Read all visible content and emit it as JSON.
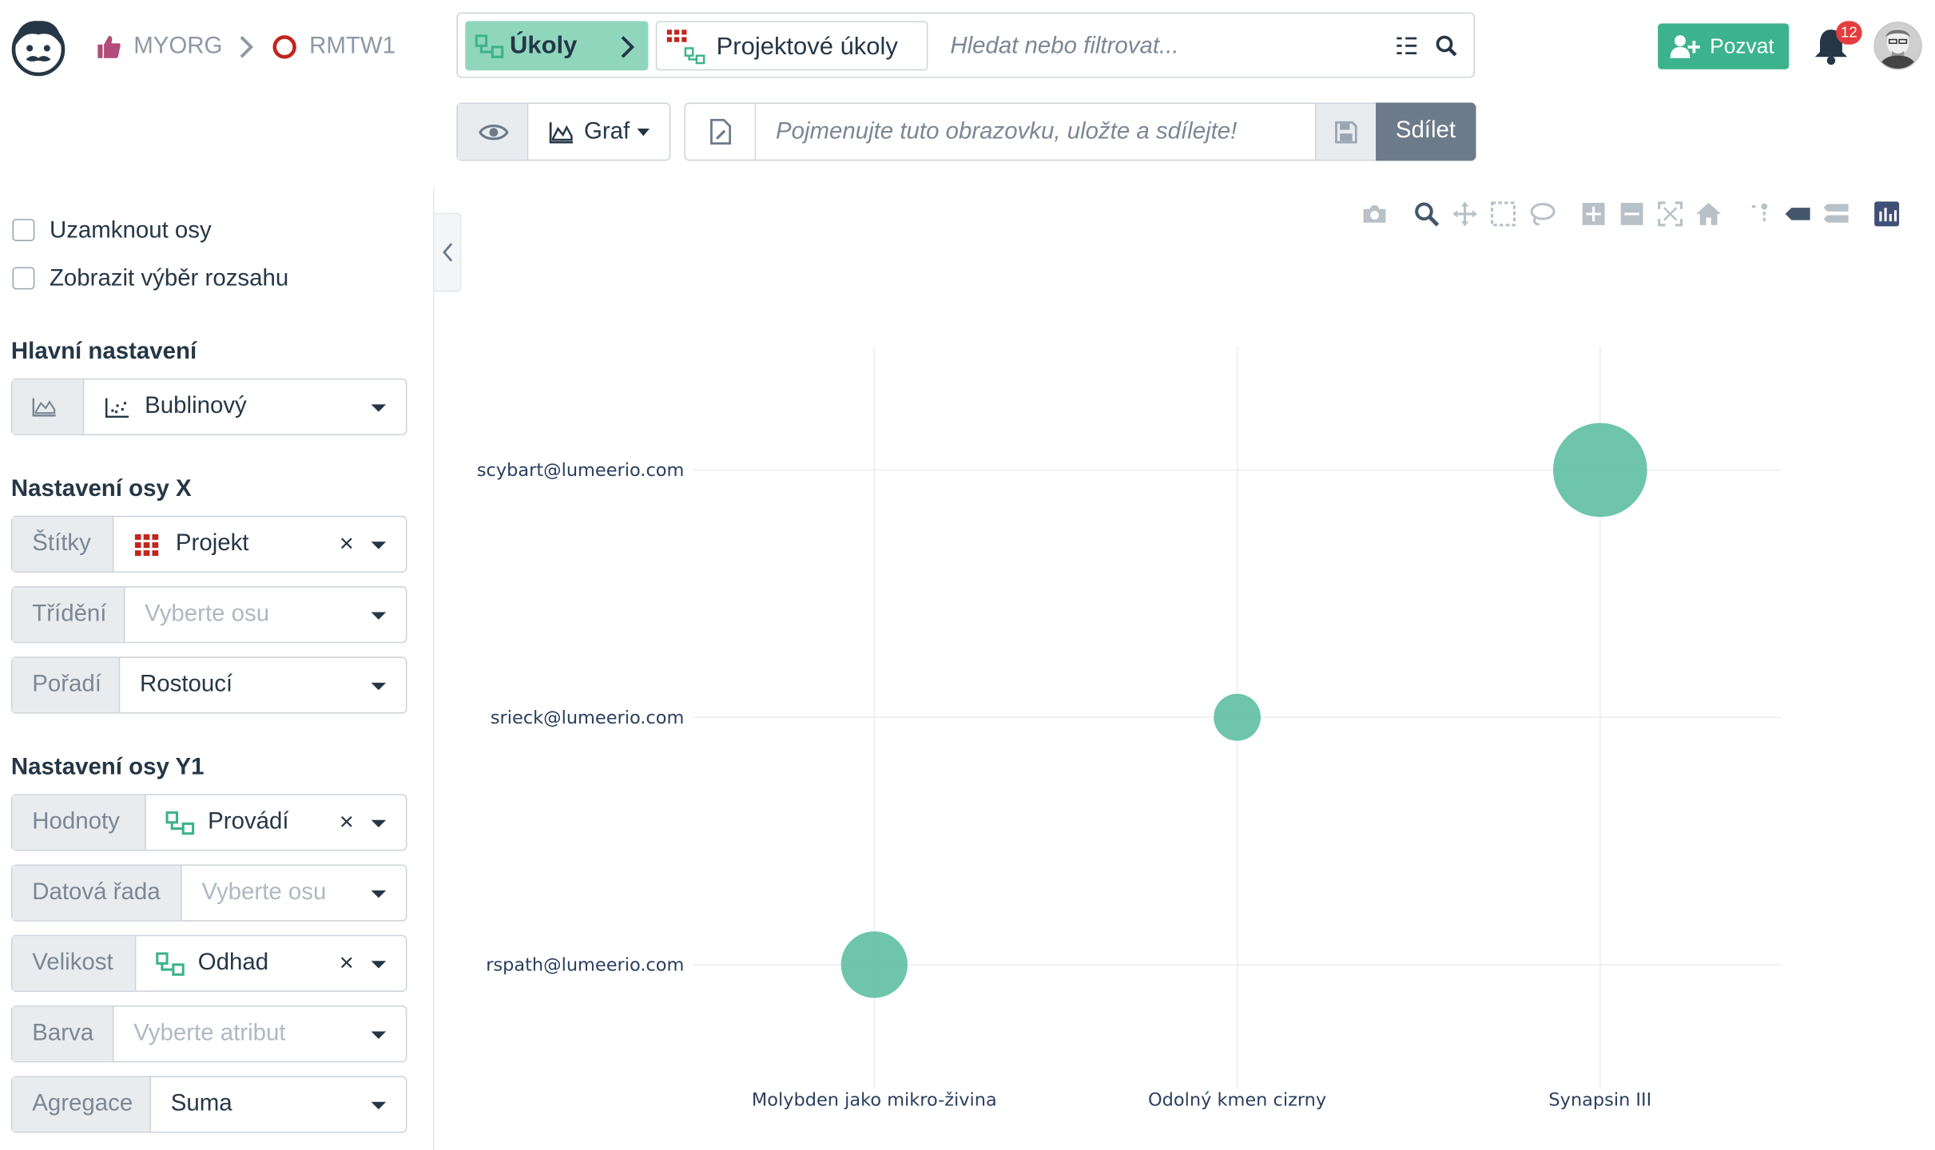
{
  "header": {
    "org": "MYORG",
    "project": "RMTW1",
    "collection_chip": "Úkoly",
    "view_chip": "Projektové úkoly",
    "search_placeholder": "Hledat nebo filtrovat...",
    "invite_label": "Pozvat",
    "notification_count": "12"
  },
  "toolbar": {
    "view_type": "Graf",
    "name_placeholder": "Pojmenujte tuto obrazovku, uložte a sdílejte!",
    "share_label": "Sdílet"
  },
  "sidebar": {
    "lock_axes": "Uzamknout osy",
    "show_range": "Zobrazit výběr rozsahu",
    "main_settings_title": "Hlavní nastavení",
    "chart_type": "Bublinový",
    "x_axis_title": "Nastavení osy X",
    "x_fields": [
      {
        "label": "Štítky",
        "value": "Projekt",
        "placeholder": false,
        "clearable": true
      },
      {
        "label": "Třídění",
        "value": "Vyberte osu",
        "placeholder": true,
        "clearable": false
      },
      {
        "label": "Pořadí",
        "value": "Rostoucí",
        "placeholder": false,
        "clearable": false
      }
    ],
    "y_axis_title": "Nastavení osy Y1",
    "y_fields": [
      {
        "label": "Hodnoty",
        "value": "Provádí",
        "placeholder": false,
        "clearable": true
      },
      {
        "label": "Datová řada",
        "value": "Vyberte osu",
        "placeholder": true,
        "clearable": false
      },
      {
        "label": "Velikost",
        "value": "Odhad",
        "placeholder": false,
        "clearable": true
      },
      {
        "label": "Barva",
        "value": "Vyberte atribut",
        "placeholder": true,
        "clearable": false
      },
      {
        "label": "Agregace",
        "value": "Suma",
        "placeholder": false,
        "clearable": false
      }
    ]
  },
  "colors": {
    "brand_green": "#3cb38c",
    "chip_green": "#8fd6bd",
    "bubble": "#66c2a5",
    "project_red": "#c0261e",
    "badge_red": "#e33d3d"
  },
  "icons": [
    "logo-icon",
    "thumbs-up-icon",
    "chevron-right-icon",
    "circle-icon",
    "tasks-icon",
    "grid-icon",
    "list-icon",
    "search-icon",
    "user-plus-icon",
    "bell-icon",
    "eye-icon",
    "area-chart-icon",
    "file-icon",
    "save-icon",
    "scatter-icon",
    "camera-icon",
    "zoom-icon",
    "pan-icon",
    "box-select-icon",
    "lasso-icon",
    "zoom-in-icon",
    "zoom-out-icon",
    "autoscale-icon",
    "home-icon",
    "spike-icon",
    "hover-closest-icon",
    "hover-compare-icon",
    "plotly-logo-icon"
  ],
  "chart_data": {
    "type": "scatter",
    "subtype": "bubble",
    "categories": [
      "Molybden jako mikro-živina",
      "Odolný kmen cizrny",
      "Synapsin III"
    ],
    "y_categories": [
      "rspath@lumeerio.com",
      "srieck@lumeerio.com",
      "scybart@lumeerio.com"
    ],
    "points": [
      {
        "x": "Molybden jako mikro-živina",
        "y": "rspath@lumeerio.com",
        "size": 2
      },
      {
        "x": "Odolný kmen cizrny",
        "y": "srieck@lumeerio.com",
        "size": 1
      },
      {
        "x": "Synapsin III",
        "y": "scybart@lumeerio.com",
        "size": 4
      }
    ],
    "grid": true
  }
}
